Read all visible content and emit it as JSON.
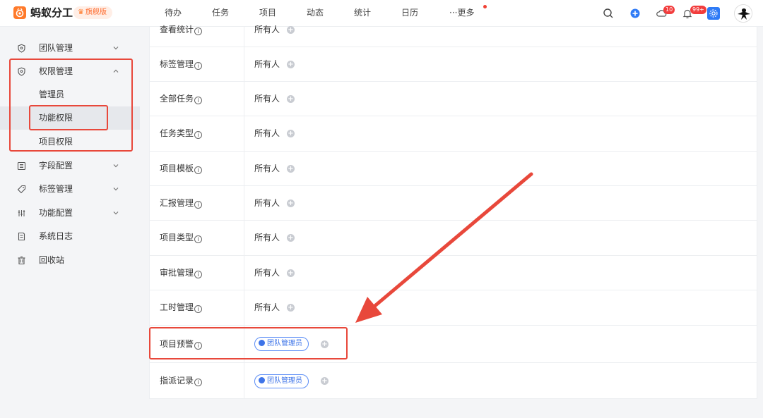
{
  "app": {
    "name": "蚂蚁分工",
    "edition": "旗舰版",
    "brand_color": "#ff7a2a"
  },
  "topnav": {
    "items": [
      "待办",
      "任务",
      "项目",
      "动态",
      "统计",
      "日历",
      "···更多"
    ],
    "cloud_badge": "10",
    "bell_badge": "99+"
  },
  "sidebar": {
    "items": [
      {
        "label": "团队管理",
        "icon": "shield-icon"
      },
      {
        "label": "权限管理",
        "icon": "shield-icon"
      },
      {
        "label": "字段配置",
        "icon": "form-icon"
      },
      {
        "label": "标签管理",
        "icon": "tag-icon"
      },
      {
        "label": "功能配置",
        "icon": "sliders-icon"
      },
      {
        "label": "系统日志",
        "icon": "log-icon"
      },
      {
        "label": "回收站",
        "icon": "trash-icon"
      }
    ],
    "sub_items": [
      "管理员",
      "功能权限",
      "项目权限"
    ],
    "active_sub": "功能权限"
  },
  "permissions": {
    "rows": [
      {
        "label": "查看统计",
        "value": "所有人"
      },
      {
        "label": "标签管理",
        "value": "所有人"
      },
      {
        "label": "全部任务",
        "value": "所有人"
      },
      {
        "label": "任务类型",
        "value": "所有人"
      },
      {
        "label": "项目模板",
        "value": "所有人"
      },
      {
        "label": "汇报管理",
        "value": "所有人"
      },
      {
        "label": "项目类型",
        "value": "所有人"
      },
      {
        "label": "审批管理",
        "value": "所有人"
      },
      {
        "label": "工时管理",
        "value": "所有人"
      },
      {
        "label": "项目预警",
        "tag": "团队管理员"
      },
      {
        "label": "指派记录",
        "tag": "团队管理员"
      }
    ],
    "info_glyph": "i",
    "add_glyph": "+"
  },
  "colors": {
    "accent": "#2f7bf6",
    "annotation_red": "#e8483b",
    "badge_red": "#f23c3c"
  }
}
